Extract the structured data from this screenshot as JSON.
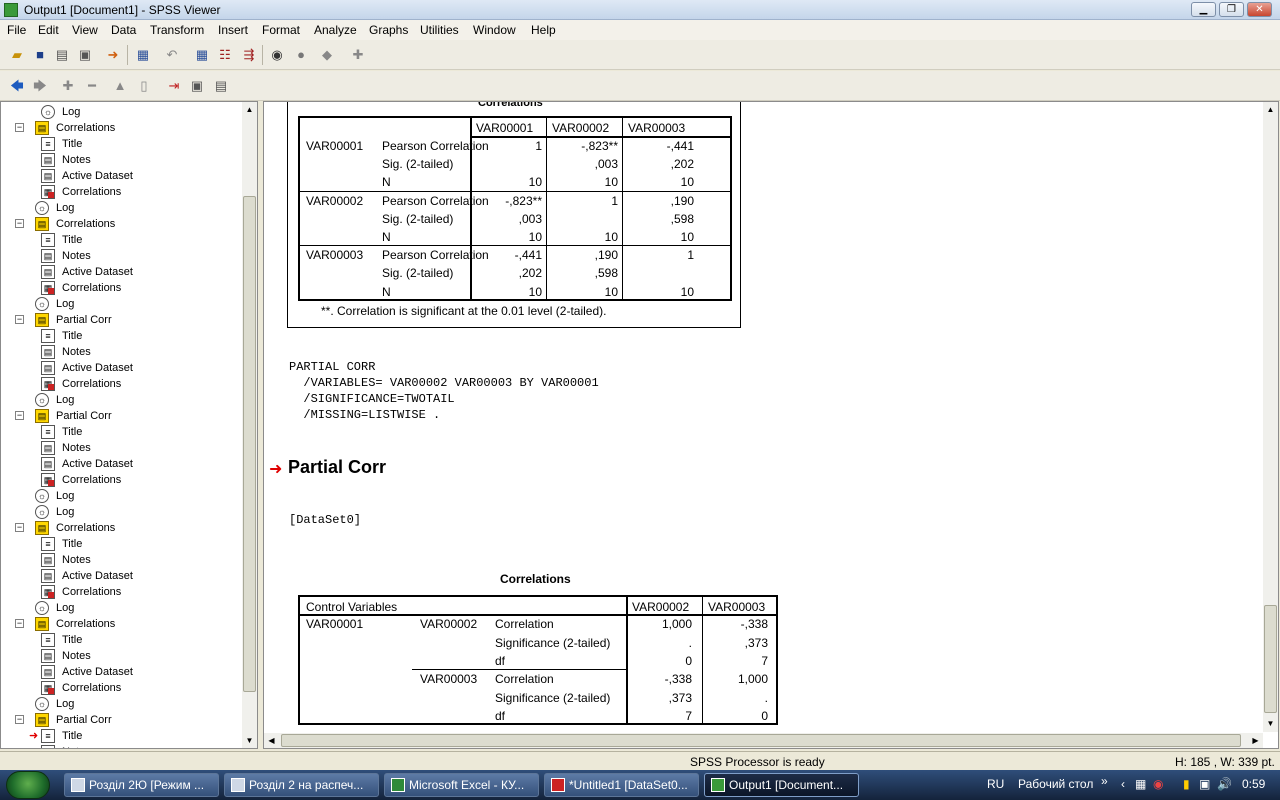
{
  "window": {
    "title": "Output1 [Document1] - SPSS Viewer"
  },
  "menu": [
    "File",
    "Edit",
    "View",
    "Data",
    "Transform",
    "Insert",
    "Format",
    "Analyze",
    "Graphs",
    "Utilities",
    "Window",
    "Help"
  ],
  "toolbar_icons": [
    "open-icon",
    "save-icon",
    "print-icon",
    "print-preview-icon",
    "export-icon",
    "dialog-recall-icon",
    "undo-icon",
    "goto-data-icon",
    "variables-icon",
    "select-cases-icon",
    "chart-icon",
    "designate-window-icon",
    "insert-icon"
  ],
  "outline": {
    "items": [
      {
        "label": "Log",
        "icon": "log",
        "level": 1
      },
      {
        "label": "Correlations",
        "icon": "book",
        "level": 0
      },
      {
        "label": "Title",
        "icon": "title",
        "level": 1
      },
      {
        "label": "Notes",
        "icon": "notes",
        "level": 1
      },
      {
        "label": "Active Dataset",
        "icon": "notes",
        "level": 1
      },
      {
        "label": "Correlations",
        "icon": "corr",
        "level": 1
      },
      {
        "label": "Log",
        "icon": "log",
        "level": 0
      },
      {
        "label": "Correlations",
        "icon": "book",
        "level": 0
      },
      {
        "label": "Title",
        "icon": "title",
        "level": 1
      },
      {
        "label": "Notes",
        "icon": "notes",
        "level": 1
      },
      {
        "label": "Active Dataset",
        "icon": "notes",
        "level": 1
      },
      {
        "label": "Correlations",
        "icon": "corr",
        "level": 1
      },
      {
        "label": "Log",
        "icon": "log",
        "level": 0
      },
      {
        "label": "Partial Corr",
        "icon": "book",
        "level": 0
      },
      {
        "label": "Title",
        "icon": "title",
        "level": 1
      },
      {
        "label": "Notes",
        "icon": "notes",
        "level": 1
      },
      {
        "label": "Active Dataset",
        "icon": "notes",
        "level": 1
      },
      {
        "label": "Correlations",
        "icon": "corr",
        "level": 1
      },
      {
        "label": "Log",
        "icon": "log",
        "level": 0
      },
      {
        "label": "Partial Corr",
        "icon": "book",
        "level": 0
      },
      {
        "label": "Title",
        "icon": "title",
        "level": 1
      },
      {
        "label": "Notes",
        "icon": "notes",
        "level": 1
      },
      {
        "label": "Active Dataset",
        "icon": "notes",
        "level": 1
      },
      {
        "label": "Correlations",
        "icon": "corr",
        "level": 1
      },
      {
        "label": "Log",
        "icon": "log",
        "level": 0
      },
      {
        "label": "Log",
        "icon": "log",
        "level": 0
      },
      {
        "label": "Correlations",
        "icon": "book",
        "level": 0
      },
      {
        "label": "Title",
        "icon": "title",
        "level": 1
      },
      {
        "label": "Notes",
        "icon": "notes",
        "level": 1
      },
      {
        "label": "Active Dataset",
        "icon": "notes",
        "level": 1
      },
      {
        "label": "Correlations",
        "icon": "corr",
        "level": 1
      },
      {
        "label": "Log",
        "icon": "log",
        "level": 0
      },
      {
        "label": "Correlations",
        "icon": "book",
        "level": 0
      },
      {
        "label": "Title",
        "icon": "title",
        "level": 1
      },
      {
        "label": "Notes",
        "icon": "notes",
        "level": 1
      },
      {
        "label": "Active Dataset",
        "icon": "notes",
        "level": 1
      },
      {
        "label": "Correlations",
        "icon": "corr",
        "level": 1
      },
      {
        "label": "Log",
        "icon": "log",
        "level": 0
      },
      {
        "label": "Partial Corr",
        "icon": "book",
        "level": 0
      },
      {
        "label": "Title",
        "icon": "title",
        "level": 1,
        "current": true
      },
      {
        "label": "Notes",
        "icon": "notes",
        "level": 1
      }
    ]
  },
  "corr_table_1": {
    "title": "Correlations",
    "headers": [
      "VAR00001",
      "VAR00002",
      "VAR00003"
    ],
    "rows": [
      {
        "var": "VAR00001",
        "stat": "Pearson Correlation",
        "v": [
          "1",
          "-,823**",
          "-,441"
        ]
      },
      {
        "var": "",
        "stat": "Sig. (2-tailed)",
        "v": [
          "",
          ",003",
          ",202"
        ]
      },
      {
        "var": "",
        "stat": "N",
        "v": [
          "10",
          "10",
          "10"
        ]
      },
      {
        "var": "VAR00002",
        "stat": "Pearson Correlation",
        "v": [
          "-,823**",
          "1",
          ",190"
        ]
      },
      {
        "var": "",
        "stat": "Sig. (2-tailed)",
        "v": [
          ",003",
          "",
          ",598"
        ]
      },
      {
        "var": "",
        "stat": "N",
        "v": [
          "10",
          "10",
          "10"
        ]
      },
      {
        "var": "VAR00003",
        "stat": "Pearson Correlation",
        "v": [
          "-,441",
          ",190",
          "1"
        ]
      },
      {
        "var": "",
        "stat": "Sig. (2-tailed)",
        "v": [
          ",202",
          ",598",
          ""
        ]
      },
      {
        "var": "",
        "stat": "N",
        "v": [
          "10",
          "10",
          "10"
        ]
      }
    ],
    "footnote": "**. Correlation is significant at the 0.01 level (2-tailed)."
  },
  "syntax": [
    "PARTIAL CORR",
    "  /VARIABLES= VAR00002 VAR00003 BY VAR00001",
    "  /SIGNIFICANCE=TWOTAIL",
    "  /MISSING=LISTWISE ."
  ],
  "heading": "Partial Corr",
  "dataset_label": "[DataSet0]",
  "corr_table_2": {
    "title": "Correlations",
    "control_header": "Control Variables",
    "headers": [
      "VAR00002",
      "VAR00003"
    ],
    "control_var": "VAR00001",
    "blocks": [
      {
        "var": "VAR00002",
        "rows": [
          {
            "stat": "Correlation",
            "v": [
              "1,000",
              "-,338"
            ]
          },
          {
            "stat": "Significance (2-tailed)",
            "v": [
              ".",
              ",373"
            ]
          },
          {
            "stat": "df",
            "v": [
              "0",
              "7"
            ]
          }
        ]
      },
      {
        "var": "VAR00003",
        "rows": [
          {
            "stat": "Correlation",
            "v": [
              "-,338",
              "1,000"
            ]
          },
          {
            "stat": "Significance (2-tailed)",
            "v": [
              ",373",
              "."
            ]
          },
          {
            "stat": "df",
            "v": [
              "7",
              "0"
            ]
          }
        ]
      }
    ]
  },
  "status": {
    "processor": "SPSS Processor  is ready",
    "dims": "H: 185 , W: 339  pt."
  },
  "taskbar": {
    "tasks": [
      "Розділ 2Ю [Режим ...",
      "Розділ 2 на распеч...",
      "Microsoft Excel - КУ...",
      "*Untitled1 [DataSet0...",
      "Output1 [Document..."
    ],
    "lang": "RU",
    "desktop": "Рабочий стол",
    "clock": "0:59"
  }
}
